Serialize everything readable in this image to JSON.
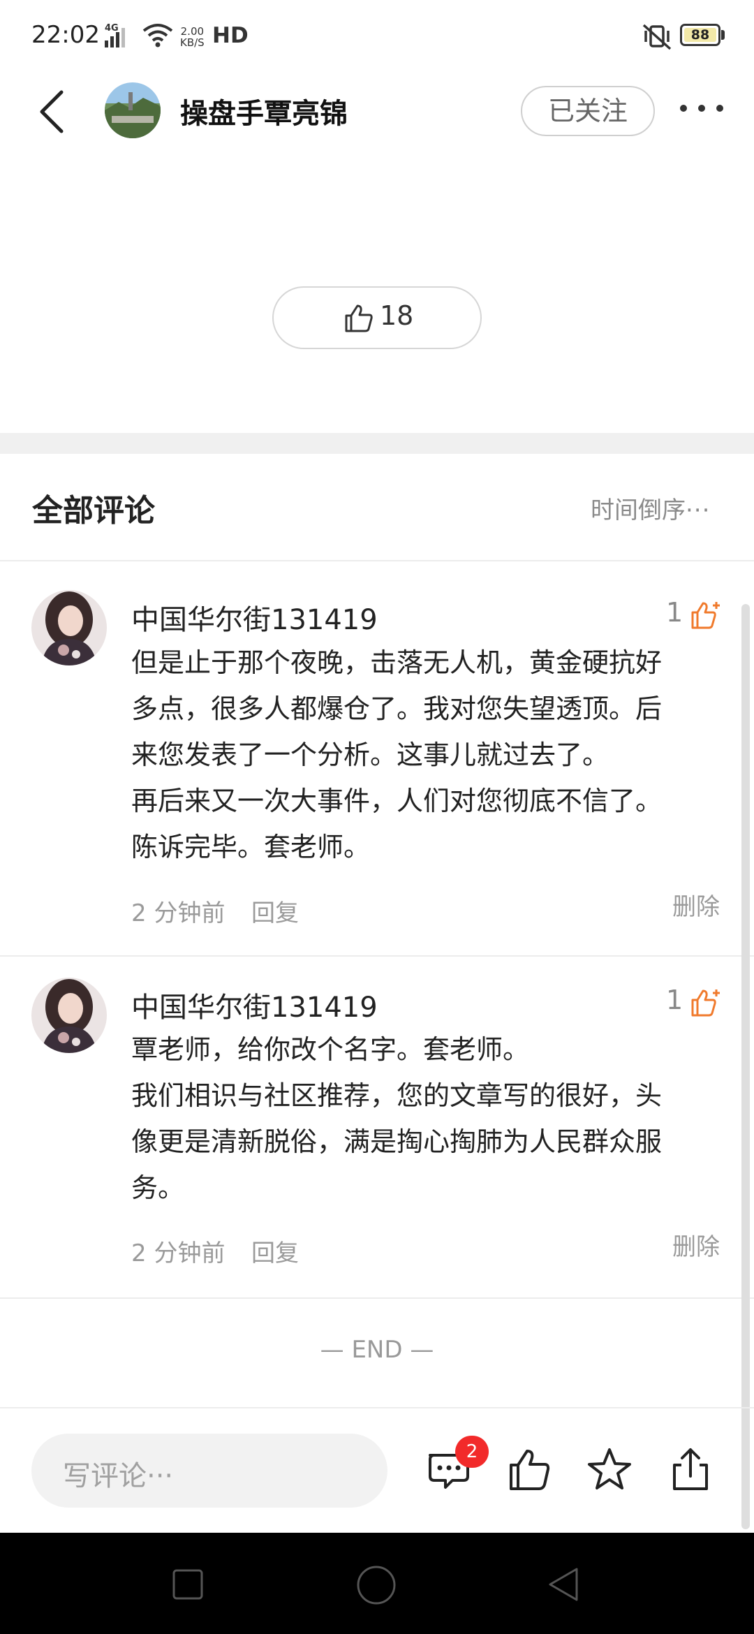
{
  "status_bar": {
    "time": "22:02",
    "network_type": "4G",
    "speed_value": "2.00",
    "speed_unit": "KB/S",
    "hd_label": "HD",
    "battery": "88"
  },
  "header": {
    "author_name": "操盘手覃亮锦",
    "follow_label": "已关注"
  },
  "post": {
    "like_count": "18"
  },
  "comments_section": {
    "title": "全部评论",
    "sort_label": "时间倒序"
  },
  "comments": [
    {
      "user": "中国华尔街131419",
      "likes": "1",
      "lines": [
        "但是止于那个夜晚，击落无人机，黄金硬抗好",
        "多点，很多人都爆仓了。我对您失望透顶。后",
        "来您发表了一个分析。这事儿就过去了。",
        "再后来又一次大事件，人们对您彻底不信了。",
        "陈诉完毕。套老师。"
      ],
      "time": "2 分钟前",
      "reply_label": "回复",
      "delete_label": "删除"
    },
    {
      "user": "中国华尔街131419",
      "likes": "1",
      "lines": [
        "覃老师，给你改个名字。套老师。",
        "我们相识与社区推荐，您的文章写的很好，头",
        "像更是清新脱俗，满是掏心掏肺为人民群众服",
        "务。"
      ],
      "time": "2 分钟前",
      "reply_label": "回复",
      "delete_label": "删除"
    }
  ],
  "end_marker": "— END —",
  "bottom_bar": {
    "input_placeholder": "写评论···",
    "comment_badge": "2"
  },
  "colors": {
    "accent_orange": "#f07a2c",
    "badge_red": "#f22a2a"
  }
}
